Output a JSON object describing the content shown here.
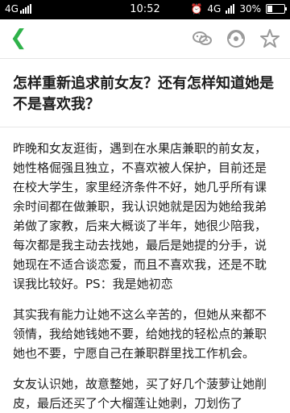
{
  "status_bar": {
    "network": "4G",
    "time": "10:52",
    "right_network": "4G",
    "battery": "30%",
    "battery_level": 0.3
  },
  "toolbar": {
    "icons": [
      "back-chevron",
      "wechat-icon",
      "share-icon",
      "star-icon"
    ]
  },
  "article": {
    "title": "怎样重新追求前女友？还有怎样知道她是不是喜欢我？",
    "paragraphs": [
      "昨晚和女友逛街，遇到在水果店兼职的前女友，她性格倔强且独立，不喜欢被人保护，目前还是在校大学生，家里经济条件不好，她几乎所有课余时间都在做兼职，我认识她就是因为她给我弟弟做了家教，后来大概谈了半年，她很少陪我，每次都是我主动去找她，最后是她提的分手，说她现在不适合谈恋爱，而且不喜欢我，还是不耽误我比较好。PS：我是她初恋",
      "其实我有能力让她不这么辛苦的，但她从来都不领情，我给她钱她不要，给她找的轻松点的兼职她也不要，宁愿自己在兼职群里找工作机会。",
      "女友认识她，故意整她，买了好几个菠萝让她削皮，最后还买了个大榴莲让她剥，刀划伤了"
    ]
  }
}
